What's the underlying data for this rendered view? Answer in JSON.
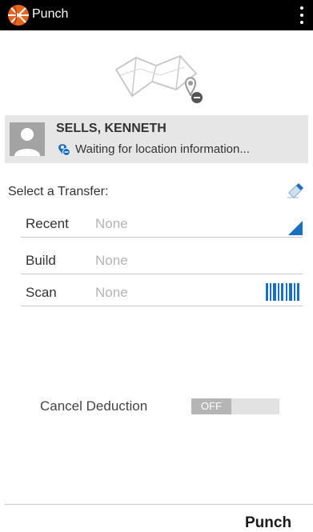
{
  "appbar": {
    "title": "Punch"
  },
  "user": {
    "name": "SELLS, KENNETH",
    "status": "Waiting for location information..."
  },
  "transfer": {
    "title": "Select a Transfer:",
    "rows": [
      {
        "label": "Recent",
        "value": "None"
      },
      {
        "label": "Build",
        "value": "None"
      },
      {
        "label": "Scan",
        "value": "None"
      }
    ]
  },
  "cancel_deduction": {
    "label": "Cancel Deduction",
    "state": "OFF"
  },
  "footer": {
    "punch_label": "Punch"
  },
  "colors": {
    "accent": "#1b6fbf",
    "logo_orange": "#e8651f",
    "user_bar": "#e6e6e6"
  }
}
